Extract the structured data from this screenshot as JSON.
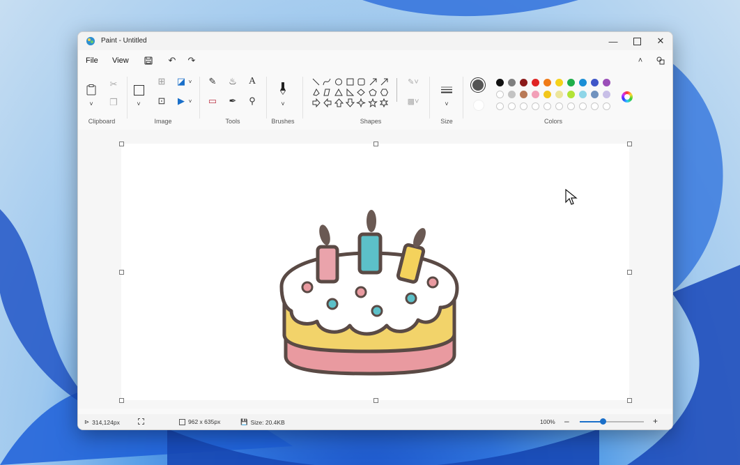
{
  "window": {
    "title": "Paint - Untitled",
    "minimize_icon": "minimize-icon",
    "maximize_icon": "maximize-icon",
    "close_icon": "close-icon"
  },
  "menu": {
    "file": "File",
    "view": "View"
  },
  "ribbon": {
    "groups": [
      "Clipboard",
      "Image",
      "Tools",
      "Brushes",
      "Shapes",
      "Size",
      "Colors"
    ],
    "colors_row1": [
      "#111111",
      "#7f7f7f",
      "#8b1a1a",
      "#e02424",
      "#f07b18",
      "#f5d21a",
      "#1fae4a",
      "#1c8fd6",
      "#3f56c8",
      "#9b4fb8"
    ],
    "colors_row2": [
      "empty",
      "#c3c3c3",
      "#b97a57",
      "#f2a0b8",
      "#f2c71b",
      "#ece59a",
      "#b3e336",
      "#8fd6e8",
      "#7092be",
      "#c8bfe7"
    ],
    "active_color": "#555555"
  },
  "status": {
    "position": "314,124px",
    "dimensions": "962 x 635px",
    "size": "Size: 20.4KB",
    "zoom": "100%"
  },
  "zoom_level": 0.36
}
